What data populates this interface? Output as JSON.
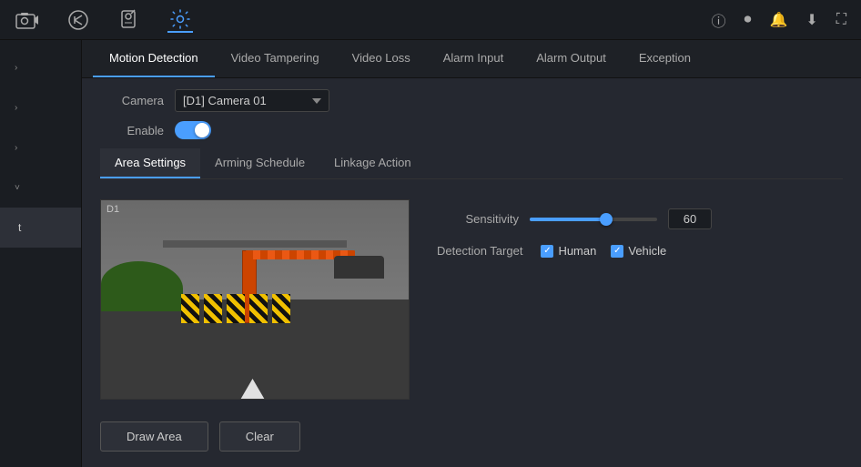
{
  "topnav": {
    "icons": [
      {
        "name": "camera-icon",
        "symbol": "📹",
        "active": false
      },
      {
        "name": "playback-icon",
        "symbol": "↺",
        "active": false
      },
      {
        "name": "search-icon",
        "symbol": "🔍",
        "active": false
      },
      {
        "name": "settings-icon",
        "symbol": "⚙",
        "active": true
      }
    ],
    "rightIcons": [
      {
        "name": "info-icon",
        "symbol": "ⓘ"
      },
      {
        "name": "record-icon",
        "symbol": "⏺"
      },
      {
        "name": "bell-icon",
        "symbol": "🔔"
      },
      {
        "name": "download-icon",
        "symbol": "⬇"
      },
      {
        "name": "fullscreen-icon",
        "symbol": "⛶"
      }
    ]
  },
  "sidebar": {
    "items": [
      {
        "label": "",
        "chevron": "›",
        "active": false
      },
      {
        "label": "",
        "chevron": "›",
        "active": false
      },
      {
        "label": "",
        "chevron": "›",
        "active": false
      },
      {
        "label": "",
        "chevron": "›",
        "active": true
      },
      {
        "label": "t",
        "chevron": "",
        "active": false
      }
    ]
  },
  "tabs": [
    {
      "label": "Motion Detection",
      "active": true
    },
    {
      "label": "Video Tampering",
      "active": false
    },
    {
      "label": "Video Loss",
      "active": false
    },
    {
      "label": "Alarm Input",
      "active": false
    },
    {
      "label": "Alarm Output",
      "active": false
    },
    {
      "label": "Exception",
      "active": false
    }
  ],
  "camera": {
    "label": "Camera",
    "value": "[D1] Camera 01"
  },
  "enable": {
    "label": "Enable",
    "checked": true
  },
  "innerTabs": [
    {
      "label": "Area Settings",
      "active": true
    },
    {
      "label": "Arming Schedule",
      "active": false
    },
    {
      "label": "Linkage Action",
      "active": false
    }
  ],
  "sensitivity": {
    "label": "Sensitivity",
    "value": "60",
    "fillPercent": 60
  },
  "detectionTarget": {
    "label": "Detection Target",
    "options": [
      {
        "label": "Human",
        "checked": true
      },
      {
        "label": "Vehicle",
        "checked": true
      }
    ]
  },
  "buttons": {
    "drawArea": "Draw Area",
    "clear": "Clear"
  }
}
